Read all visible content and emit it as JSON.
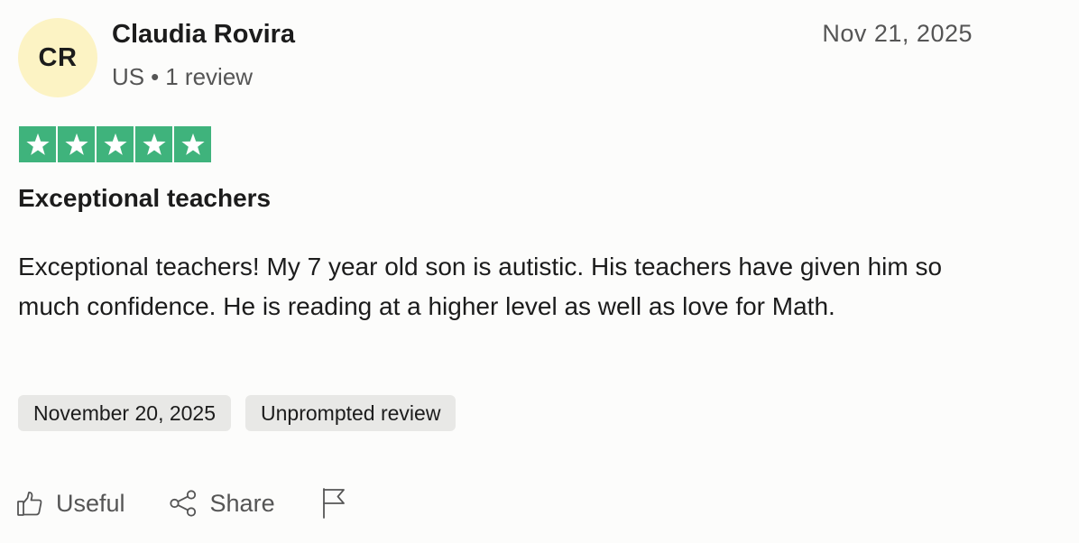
{
  "reviewer": {
    "initials": "CR",
    "name": "Claudia Rovira",
    "country": "US",
    "separator": "•",
    "review_count": "1 review",
    "avatar_color": "#fcf3c4"
  },
  "review": {
    "date": "Nov 21, 2025",
    "rating": 5,
    "rating_max": 5,
    "star_color": "#3fb37c",
    "title": "Exceptional teachers",
    "text": "Exceptional teachers! My 7 year old son is autistic. His teachers have given him so much confidence. He is reading at a higher level as well as love for Math.",
    "tags": [
      "November 20, 2025",
      "Unprompted review"
    ]
  },
  "actions": {
    "useful_label": "Useful",
    "useful_icon": "thumbs-up-icon",
    "share_label": "Share",
    "share_icon": "share-icon",
    "report_icon": "flag-icon"
  }
}
